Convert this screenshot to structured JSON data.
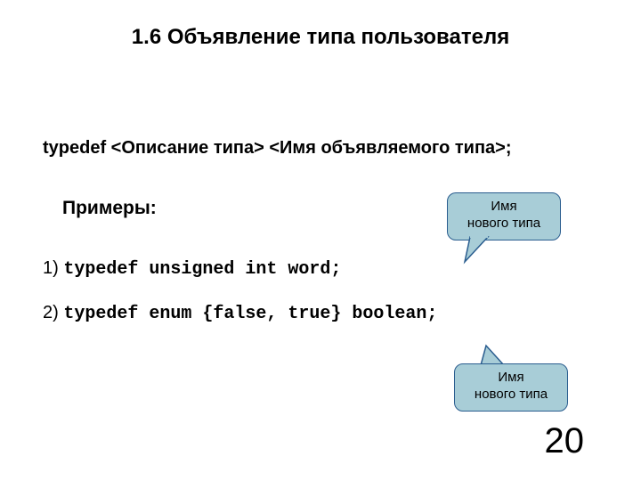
{
  "title": "1.6 Объявление типа пользователя",
  "syntax": "typedef <Описание типа> <Имя объявляемого типа>;",
  "examples_label": "Примеры:",
  "example1": {
    "num": "1) ",
    "code": "typedef unsigned int word;"
  },
  "example2": {
    "num": "2) ",
    "code": "typedef enum {false, true} boolean;"
  },
  "callout1": {
    "line1": "Имя",
    "line2": "нового типа"
  },
  "callout2": {
    "line1": "Имя",
    "line2": "нового типа"
  },
  "page_number": "20"
}
